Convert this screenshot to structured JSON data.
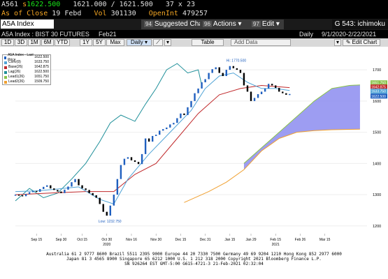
{
  "quote_line1": {
    "ticker": "A561",
    "direction": "s",
    "last": "1622.500",
    "range": "1621.000 / 1621.500",
    "size": "37 x 23"
  },
  "quote_line2": {
    "label": "As of Close",
    "date": "19 Febd",
    "vol_label": "Vol",
    "vol": "301130",
    "oi_label": "OpenInt",
    "oi": "479257"
  },
  "toolbar": {
    "ticker": "A5A Index",
    "suggested": {
      "num": "94",
      "label": "Suggested Charts"
    },
    "actions": {
      "num": "96",
      "label": "Actions"
    },
    "edit": {
      "num": "97",
      "label": "Edit"
    },
    "chart_id": "G 543: ichimoku"
  },
  "subtitle": {
    "name": "A5A Index : BIST 30 FUTURES",
    "contract": "Feb21",
    "freq": "Daily",
    "range": "9/1/2020-2/22/2021"
  },
  "periods": [
    "1D",
    "3D",
    "1M",
    "6M",
    "YTD",
    "1Y",
    "5Y",
    "Max"
  ],
  "period_freq": "Daily",
  "table_label": "Table",
  "add_data_label": "Add Data",
  "edit_chart_label": "Edit Chart",
  "colors": {
    "price": "#1f5fbf",
    "conv": "#4fa3d6",
    "base": "#c0282a",
    "lag": "#20909a",
    "lead1": "#8ac34a",
    "lead2": "#f0a030",
    "cloud": "#8c8cf0"
  },
  "chart_data": {
    "type": "line",
    "legend": [
      {
        "name": "A5A Index - Last Price",
        "value": "1622.500",
        "color": "#1f5fbf"
      },
      {
        "name": "Conv(9)",
        "value": "1633.750",
        "color": "#4fa3d6"
      },
      {
        "name": "Base(26)",
        "value": "1642.875",
        "color": "#c0282a"
      },
      {
        "name": "Lag(26)",
        "value": "1622.500",
        "color": "#20909a"
      },
      {
        "name": "Lead1(26)",
        "value": "1651.750",
        "color": "#8ac34a"
      },
      {
        "name": "Lead2(26)",
        "value": "1509.750",
        "color": "#f0a030"
      }
    ],
    "y_ticks": [
      "1700",
      "1600",
      "1500",
      "1400",
      "1300",
      "1200"
    ],
    "ylim": [
      1175,
      1765
    ],
    "x_ticks": [
      "Sep 15",
      "Sep 30",
      "Oct 15",
      "Oct 30",
      "Nov 16",
      "Nov 30",
      "Dec 15",
      "Dec 31",
      "Jan 15",
      "Jan 29",
      "Feb 15",
      "Feb 26",
      "Mar 15"
    ],
    "x_year_labels": [
      "2020",
      "2021"
    ],
    "hi_label": "Hi: 1770.500",
    "low_label": "Low: 1232.750",
    "right_value_labels": [
      "1651.750",
      "1642.875",
      "1633.750",
      "1622.500"
    ],
    "price": [
      [
        0,
        1300
      ],
      [
        1,
        1298
      ],
      [
        2,
        1295
      ],
      [
        3,
        1302
      ],
      [
        4,
        1308
      ],
      [
        5,
        1312
      ],
      [
        6,
        1309
      ],
      [
        7,
        1318
      ],
      [
        8,
        1325
      ],
      [
        9,
        1330
      ],
      [
        10,
        1320
      ],
      [
        11,
        1315
      ],
      [
        12,
        1310
      ],
      [
        13,
        1305
      ],
      [
        14,
        1316
      ],
      [
        15,
        1326
      ],
      [
        16,
        1340
      ],
      [
        17,
        1350
      ],
      [
        18,
        1330
      ],
      [
        19,
        1320
      ],
      [
        20,
        1315
      ],
      [
        21,
        1305
      ],
      [
        22,
        1298
      ],
      [
        23,
        1290
      ],
      [
        24,
        1270
      ],
      [
        25,
        1245
      ],
      [
        26,
        1232.75
      ],
      [
        27,
        1265
      ],
      [
        28,
        1300
      ],
      [
        29,
        1350
      ],
      [
        30,
        1395
      ],
      [
        31,
        1415
      ],
      [
        32,
        1420
      ],
      [
        33,
        1410
      ],
      [
        34,
        1405
      ],
      [
        35,
        1398
      ],
      [
        36,
        1430
      ],
      [
        37,
        1480
      ],
      [
        38,
        1470
      ],
      [
        39,
        1488
      ],
      [
        40,
        1492
      ],
      [
        41,
        1505
      ],
      [
        42,
        1510
      ],
      [
        43,
        1515
      ],
      [
        44,
        1525
      ],
      [
        45,
        1530
      ],
      [
        46,
        1545
      ],
      [
        47,
        1560
      ],
      [
        48,
        1555
      ],
      [
        49,
        1580
      ],
      [
        50,
        1600
      ],
      [
        51,
        1625
      ],
      [
        52,
        1640
      ],
      [
        53,
        1660
      ],
      [
        54,
        1670
      ],
      [
        55,
        1690
      ],
      [
        56,
        1702
      ],
      [
        57,
        1708
      ],
      [
        58,
        1690
      ],
      [
        59,
        1680
      ],
      [
        60,
        1700
      ],
      [
        61,
        1712
      ],
      [
        62,
        1705
      ],
      [
        63,
        1700
      ],
      [
        64,
        1690
      ],
      [
        65,
        1650
      ],
      [
        66,
        1630
      ],
      [
        67,
        1600
      ],
      [
        68,
        1610
      ],
      [
        69,
        1622
      ],
      [
        70,
        1630
      ],
      [
        71,
        1640
      ],
      [
        72,
        1655
      ],
      [
        73,
        1650
      ],
      [
        74,
        1642
      ],
      [
        75,
        1630
      ],
      [
        76,
        1625
      ],
      [
        77,
        1620
      ],
      [
        78,
        1622.5
      ]
    ],
    "conv": [
      [
        0,
        1310
      ],
      [
        6,
        1312
      ],
      [
        12,
        1318
      ],
      [
        18,
        1325
      ],
      [
        24,
        1285
      ],
      [
        28,
        1270
      ],
      [
        32,
        1350
      ],
      [
        38,
        1430
      ],
      [
        44,
        1500
      ],
      [
        50,
        1570
      ],
      [
        54,
        1640
      ],
      [
        58,
        1680
      ],
      [
        62,
        1690
      ],
      [
        66,
        1660
      ],
      [
        70,
        1640
      ],
      [
        74,
        1640
      ],
      [
        78,
        1633.75
      ]
    ],
    "base": [
      [
        0,
        1300
      ],
      [
        10,
        1305
      ],
      [
        20,
        1310
      ],
      [
        28,
        1310
      ],
      [
        34,
        1365
      ],
      [
        40,
        1400
      ],
      [
        46,
        1480
      ],
      [
        52,
        1560
      ],
      [
        58,
        1620
      ],
      [
        64,
        1640
      ],
      [
        70,
        1650
      ],
      [
        78,
        1642.875
      ]
    ],
    "lag": [
      [
        0,
        1280
      ],
      [
        4,
        1320
      ],
      [
        8,
        1290
      ],
      [
        12,
        1305
      ],
      [
        16,
        1350
      ],
      [
        20,
        1400
      ],
      [
        24,
        1470
      ],
      [
        27,
        1530
      ],
      [
        30,
        1555
      ],
      [
        34,
        1535
      ],
      [
        37,
        1590
      ],
      [
        40,
        1640
      ],
      [
        43,
        1700
      ],
      [
        46,
        1720
      ],
      [
        49,
        1690
      ],
      [
        52,
        1700
      ],
      [
        53,
        1650
      ]
    ],
    "lead1": [
      [
        65,
        1400
      ],
      [
        70,
        1450
      ],
      [
        75,
        1500
      ],
      [
        80,
        1550
      ],
      [
        85,
        1600
      ],
      [
        90,
        1640
      ],
      [
        95,
        1650
      ],
      [
        98,
        1651.75
      ]
    ],
    "lead2": [
      [
        48,
        1275
      ],
      [
        55,
        1310
      ],
      [
        60,
        1340
      ],
      [
        65,
        1380
      ],
      [
        70,
        1440
      ],
      [
        75,
        1480
      ],
      [
        80,
        1500
      ],
      [
        85,
        1505
      ],
      [
        90,
        1508
      ],
      [
        95,
        1509
      ],
      [
        98,
        1509.75
      ]
    ]
  },
  "footer_lines": [
    "Australia 61 2 9777 8600 Brazil 5511 2395 9000 Europe 44 20 7330 7500 Germany 49 69 9204 1210 Hong Kong 852 2977 6000",
    "Japan 81 3 4565 8900 Singapore 65 6212 1000 U.S. 1 212 318 2000 Copyright 2021 Bloomberg Finance L.P.",
    "SN 926264 EST GMT-5:00 G615-4721-3 21-Feb-2021 02:32:04"
  ]
}
